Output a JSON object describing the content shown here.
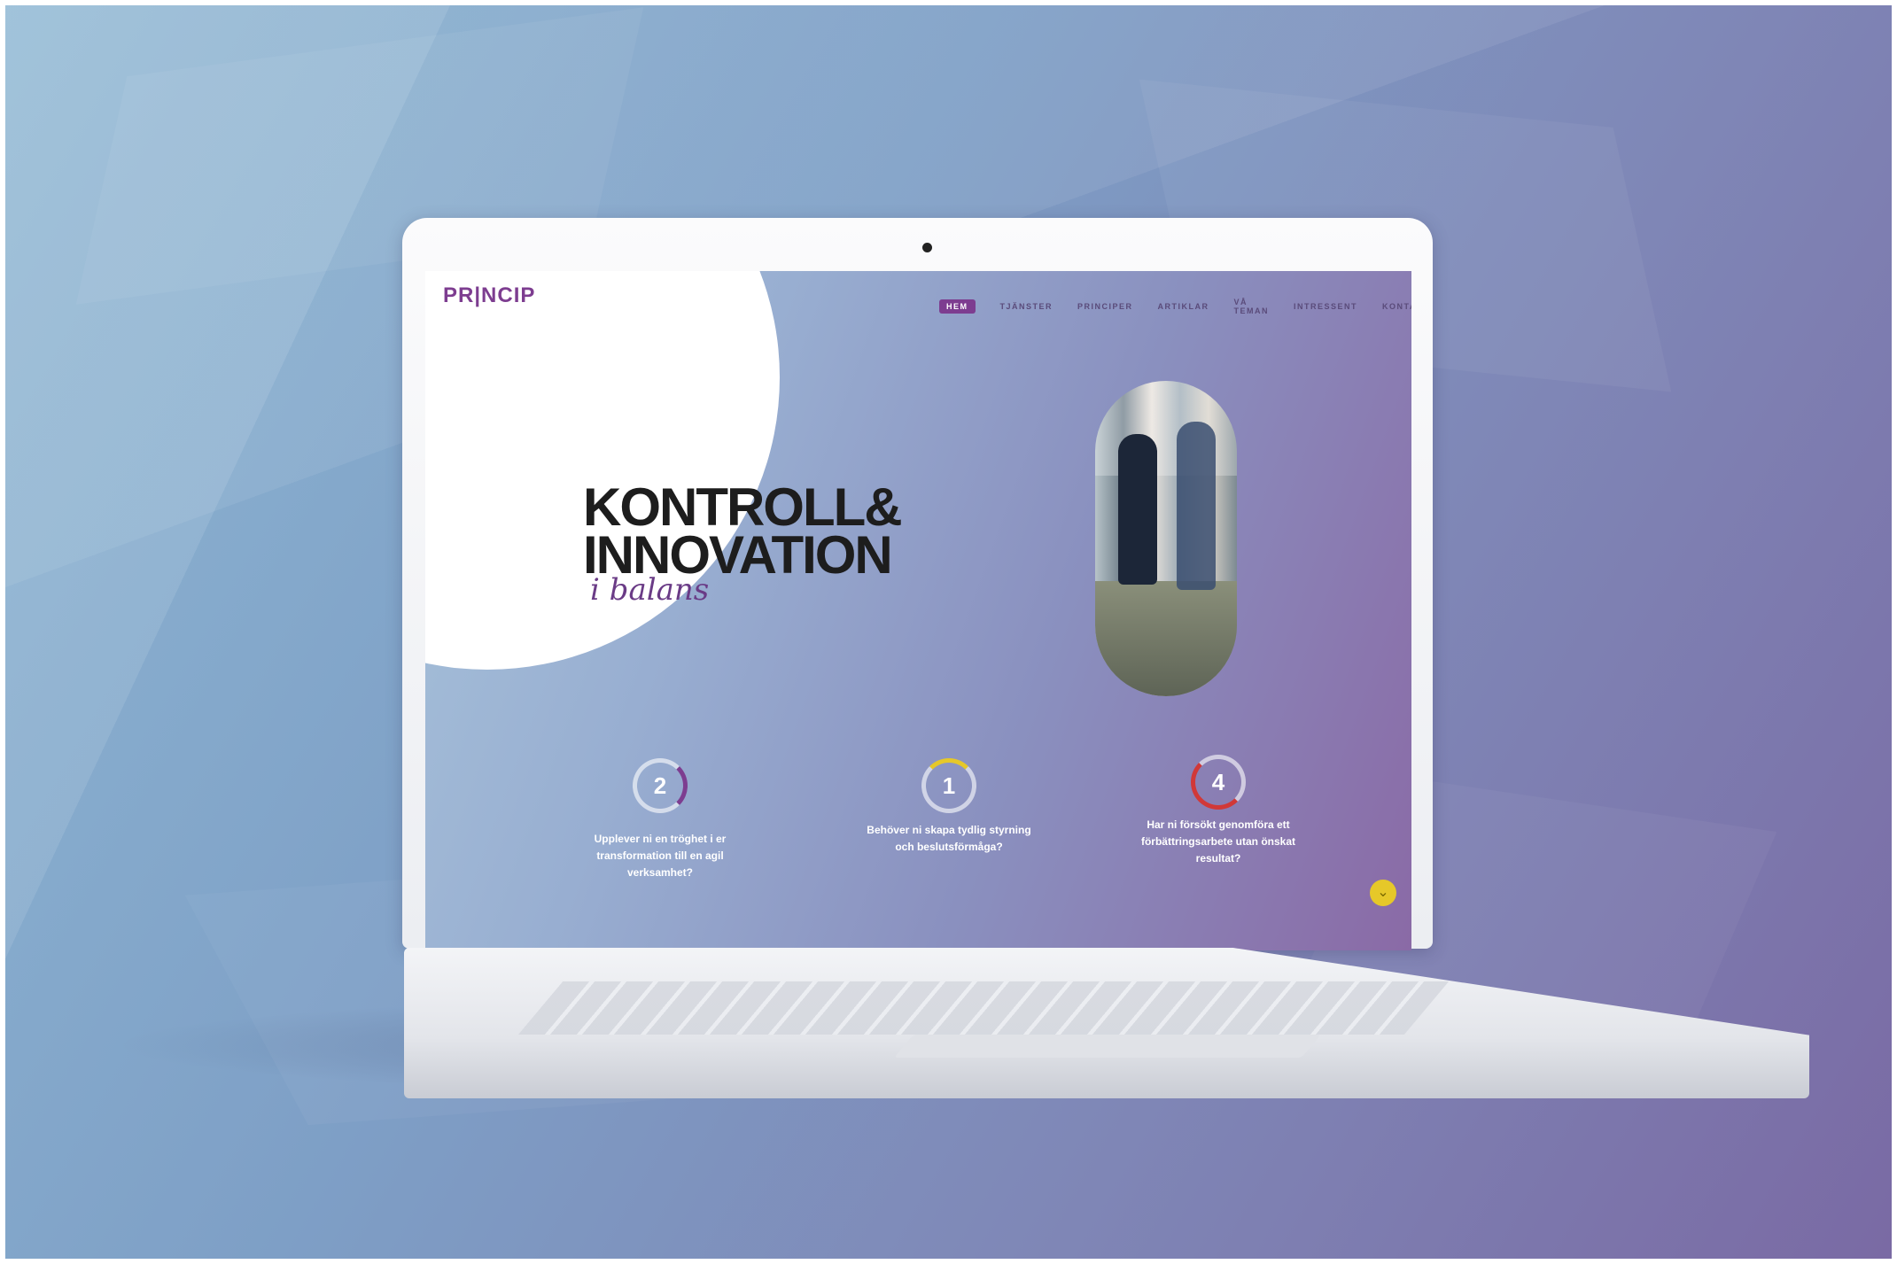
{
  "site": {
    "logo": "PR|NCIP",
    "nav": [
      "HEM",
      "TJÄNSTER",
      "PRINCIPER",
      "ARTIKLAR",
      "VÅ TEMAN",
      "INTRESSENT",
      "KONTAKT"
    ],
    "hero": {
      "title_line1": "KONTROLL&",
      "title_line2": "INNOVATION",
      "subtitle": "i balans"
    },
    "cards": [
      {
        "number": "2",
        "text": "Upplever ni en tröghet i er transformation till en agil verksamhet?"
      },
      {
        "number": "1",
        "text": "Behöver ni skapa tydlig styrning och beslutsförmåga?"
      },
      {
        "number": "4",
        "text": "Har ni försökt genomföra ett förbättringsarbete utan önskat resultat?"
      }
    ],
    "scroll_button": "⌄"
  },
  "colors": {
    "brand_purple": "#7d3d90",
    "accent_yellow": "#e6c829",
    "accent_red": "#d13838"
  }
}
